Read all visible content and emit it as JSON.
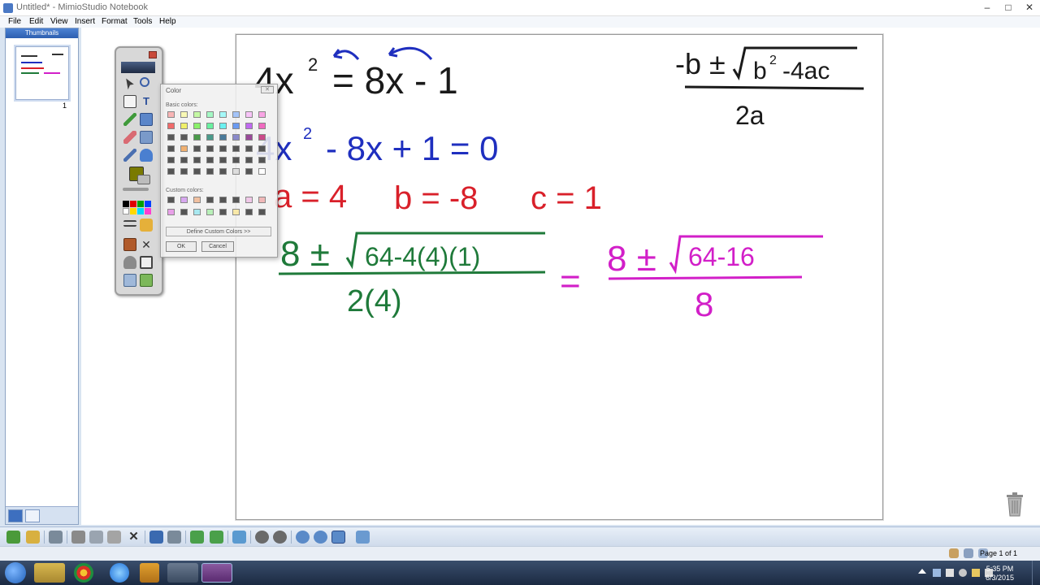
{
  "window": {
    "title": "Untitled* - MimioStudio Notebook",
    "minimize_glyph": "–",
    "maximize_glyph": "□",
    "close_glyph": "✕"
  },
  "menu": [
    "File",
    "Edit",
    "View",
    "Insert",
    "Format",
    "Tools",
    "Help"
  ],
  "left_panel": {
    "header": "Thumbnails",
    "thumbnail_number": "1"
  },
  "color_dialog": {
    "title": "Color",
    "close_glyph": "✕",
    "basic_colors_label": "Basic colors:",
    "custom_colors_label": "Custom colors:",
    "define_custom_label": "Define Custom Colors >>",
    "ok_label": "OK",
    "cancel_label": "Cancel"
  },
  "page_text": {
    "eq1_lhs": "4x",
    "eq1_exp": "2",
    "eq1_rhs": "= 8x - 1",
    "eq2": "4x",
    "eq2_exp": "2",
    "eq2_rest": "- 8x + 1 = 0",
    "a_val": "a = 4",
    "b_val": "b = -8",
    "c_val": "c = 1",
    "formula_top_left": "-b ±",
    "formula_radicand": "b",
    "formula_radicand_exp": "2",
    "formula_radicand_rest": "-4ac",
    "formula_denominator": "2a",
    "step1_num_left": "8 ±",
    "step1_radicand": "64-4(4)(1)",
    "step1_denominator": "2(4)",
    "equals": "=",
    "step2_num_left": "8 ±",
    "step2_radicand": "64-16",
    "step2_denominator": "8"
  },
  "ink_colors": {
    "black": "#1a1a1a",
    "blue": "#1f2fbf",
    "red": "#d9202a",
    "green": "#1f7a3a",
    "magenta": "#d21fc8"
  },
  "status": {
    "page_indicator": "Page 1 of 1"
  },
  "clock": {
    "time": "5:35 PM",
    "date": "6/3/2015"
  }
}
